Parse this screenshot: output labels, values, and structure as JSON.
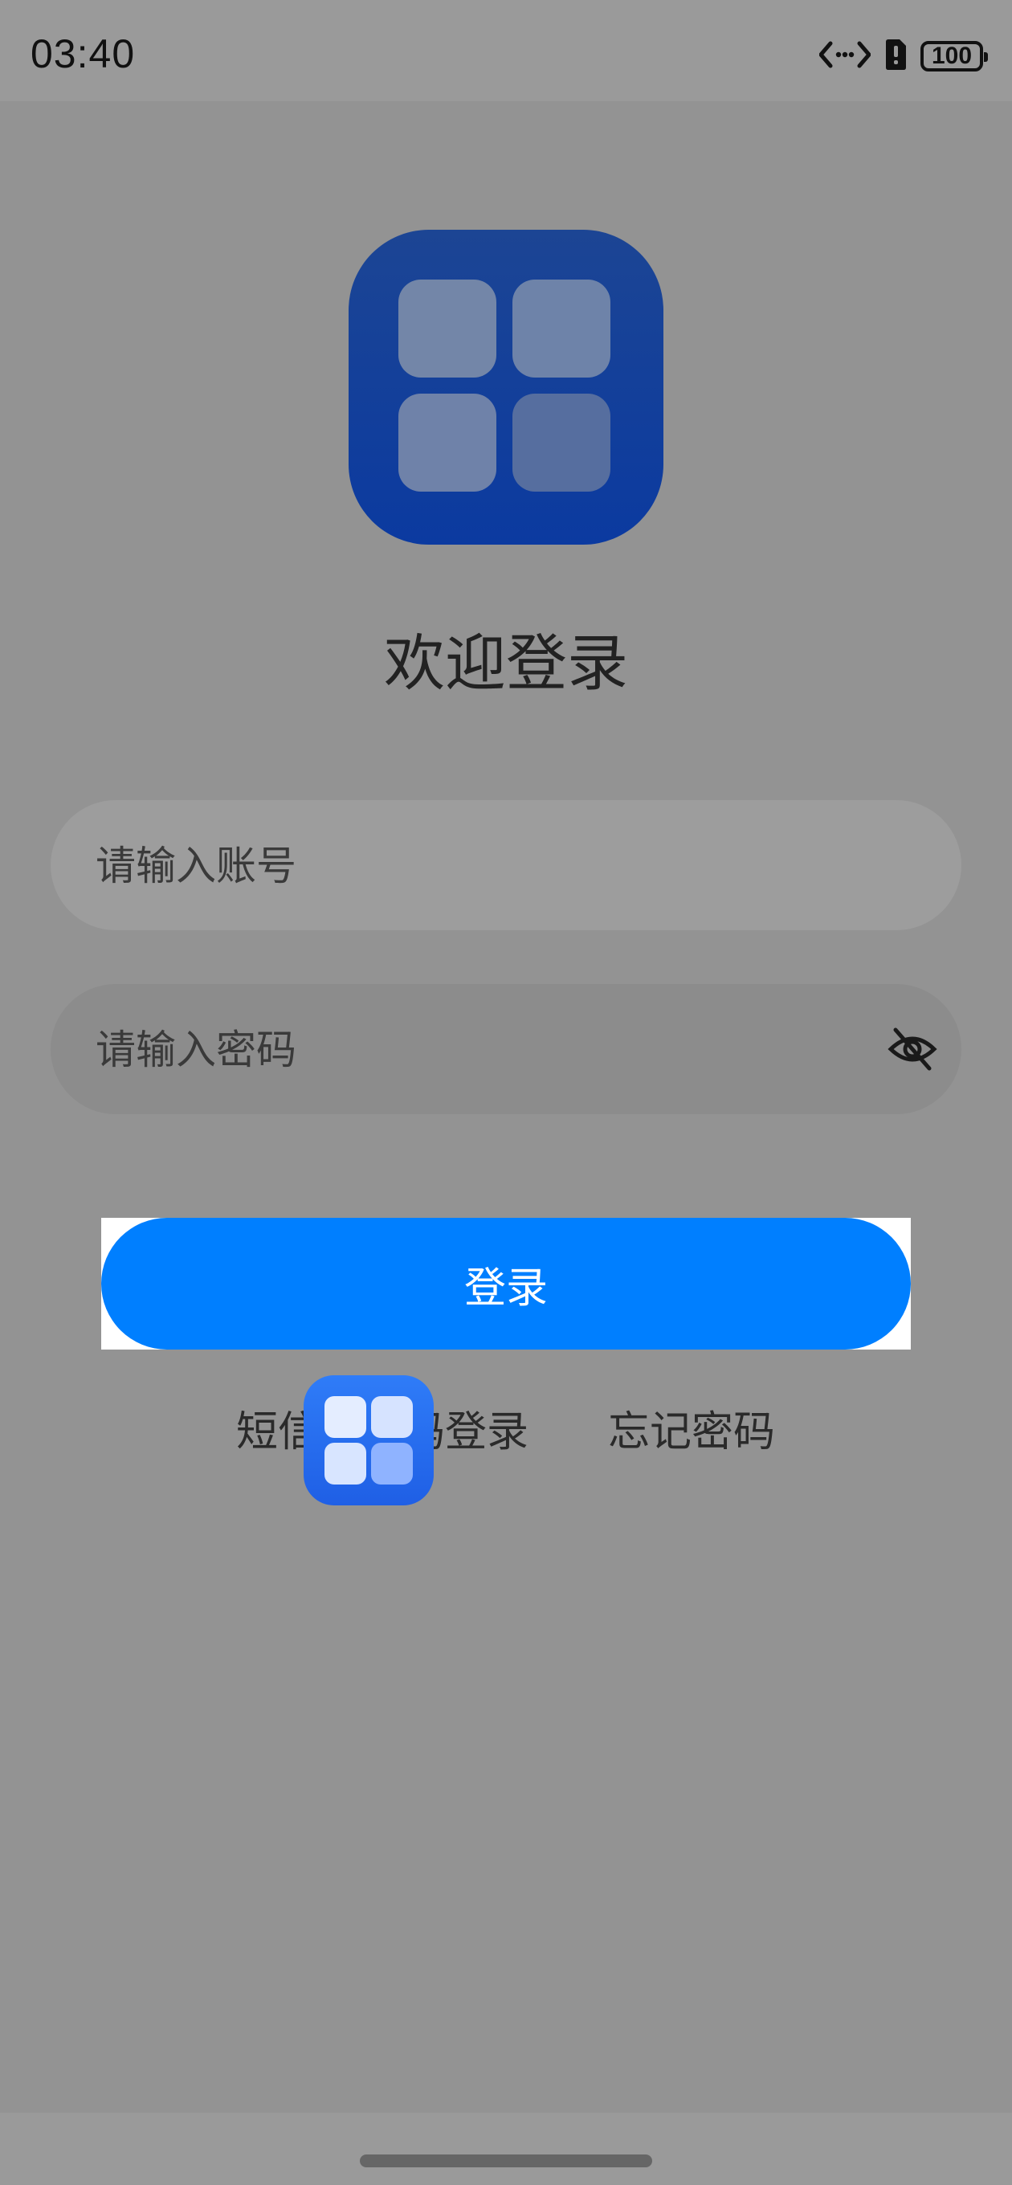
{
  "status_bar": {
    "time": "03:40",
    "battery_level": "100",
    "icons": [
      "data-transfer-icon",
      "battery-alert-icon",
      "battery-icon"
    ]
  },
  "app": {
    "logo_icon": "app-grid-icon",
    "welcome_title": "欢迎登录"
  },
  "form": {
    "account_placeholder": "请输入账号",
    "account_value": "",
    "password_placeholder": "请输入密码",
    "password_value": "",
    "password_toggle_icon": "eye-off-icon"
  },
  "actions": {
    "login_label": "登录",
    "sms_login_label": "短信验证码登录",
    "forgot_password_label": "忘记密码"
  },
  "overlay": {
    "floating_app_icon": "app-grid-icon"
  },
  "colors": {
    "primary_button": "#007fff",
    "logo_blue": "#0b3aa0",
    "dim_overlay": "#939393"
  }
}
